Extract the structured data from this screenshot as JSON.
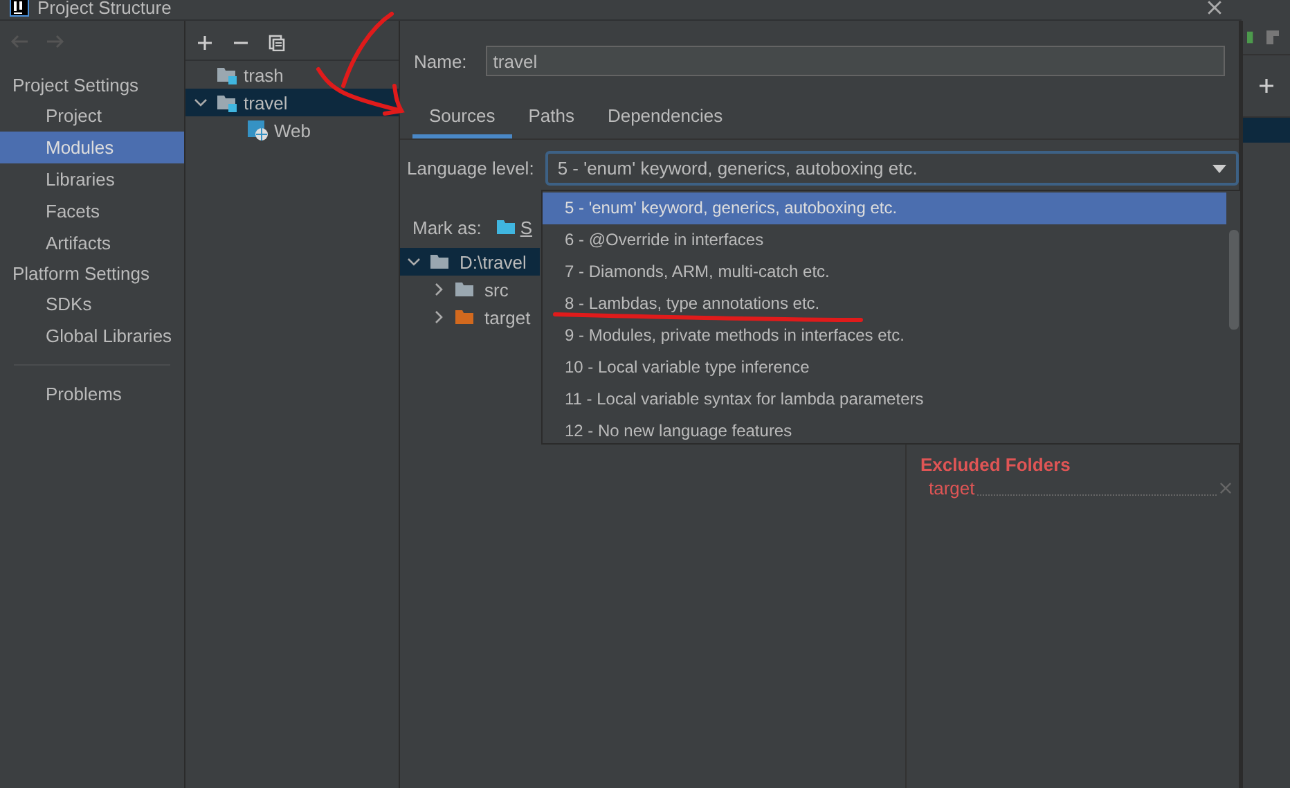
{
  "window": {
    "title": "Project Structure"
  },
  "sidebar": {
    "sections": [
      {
        "title": "Project Settings",
        "items": [
          {
            "label": "Project",
            "selected": false
          },
          {
            "label": "Modules",
            "selected": true
          },
          {
            "label": "Libraries",
            "selected": false
          },
          {
            "label": "Facets",
            "selected": false
          },
          {
            "label": "Artifacts",
            "selected": false
          }
        ]
      },
      {
        "title": "Platform Settings",
        "items": [
          {
            "label": "SDKs",
            "selected": false
          },
          {
            "label": "Global Libraries",
            "selected": false
          }
        ]
      }
    ],
    "bottom_items": [
      {
        "label": "Problems",
        "selected": false
      }
    ]
  },
  "modules_tree": [
    {
      "label": "trash",
      "kind": "module",
      "selected": false
    },
    {
      "label": "travel",
      "kind": "module",
      "selected": true,
      "expanded": true,
      "children": [
        {
          "label": "Web",
          "kind": "web",
          "selected": false
        }
      ]
    }
  ],
  "name_field": {
    "label": "Name:",
    "value": "travel"
  },
  "tabs": [
    {
      "label": "Sources",
      "selected": true
    },
    {
      "label": "Paths",
      "selected": false
    },
    {
      "label": "Dependencies",
      "selected": false
    }
  ],
  "language_level": {
    "label": "Language level:",
    "value": "5 - 'enum' keyword, generics, autoboxing etc.",
    "options": [
      {
        "label": "5 - 'enum' keyword, generics, autoboxing etc.",
        "selected": true
      },
      {
        "label": "6 - @Override in interfaces",
        "selected": false
      },
      {
        "label": "7 - Diamonds, ARM, multi-catch etc.",
        "selected": false
      },
      {
        "label": "8 - Lambdas, type annotations etc.",
        "selected": false
      },
      {
        "label": "9 - Modules, private methods in interfaces etc.",
        "selected": false
      },
      {
        "label": "10 - Local variable type inference",
        "selected": false
      },
      {
        "label": "11 - Local variable syntax for lambda parameters",
        "selected": false
      },
      {
        "label": "12 - No new language features",
        "selected": false
      }
    ]
  },
  "mark_as": {
    "label": "Mark as:",
    "buttons": [
      "S"
    ]
  },
  "content_tree": [
    {
      "label": "D:\\travel",
      "kind": "folder",
      "selected": true,
      "expanded": true,
      "children": [
        {
          "label": "src",
          "kind": "folder",
          "selected": false,
          "expanded": false
        },
        {
          "label": "target",
          "kind": "excluded",
          "selected": false,
          "expanded": false
        }
      ]
    }
  ],
  "excluded_folders": {
    "title": "Excluded Folders",
    "items": [
      "target"
    ]
  }
}
